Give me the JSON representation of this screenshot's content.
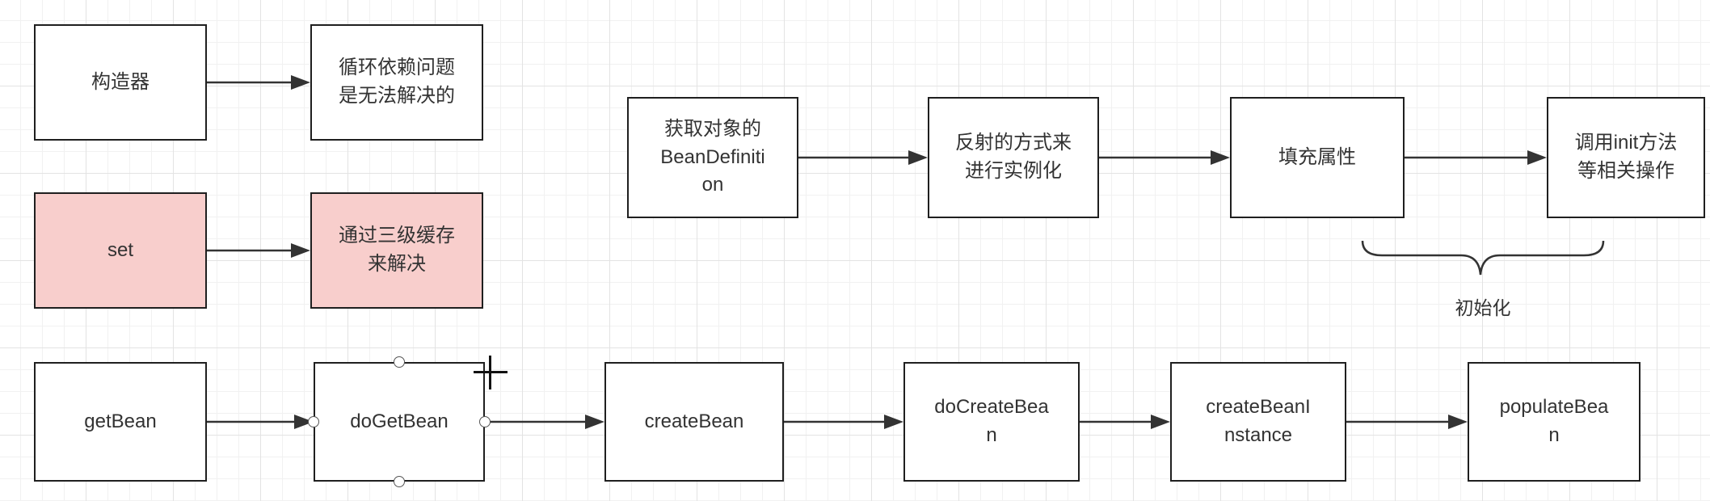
{
  "left_panel": {
    "constructor": "构造器",
    "constructor_note": "循环依赖问题\n是无法解决的",
    "setter": "set",
    "setter_note": "通过三级缓存\n来解决"
  },
  "lifecycle": {
    "steps": [
      "获取对象的\nBeanDefiniti\non",
      "反射的方式来\n进行实例化",
      "填充属性",
      "调用init方法\n等相关操作"
    ],
    "brace_label": "初始化"
  },
  "call_chain": {
    "steps": [
      "getBean",
      "doGetBean",
      "createBean",
      "doCreateBea\nn",
      "createBeanI\nnstance",
      "populateBea\nn"
    ]
  },
  "colors": {
    "pink_fill": "#f8cecc",
    "border": "#1f1f1f",
    "arrow": "#333333"
  }
}
